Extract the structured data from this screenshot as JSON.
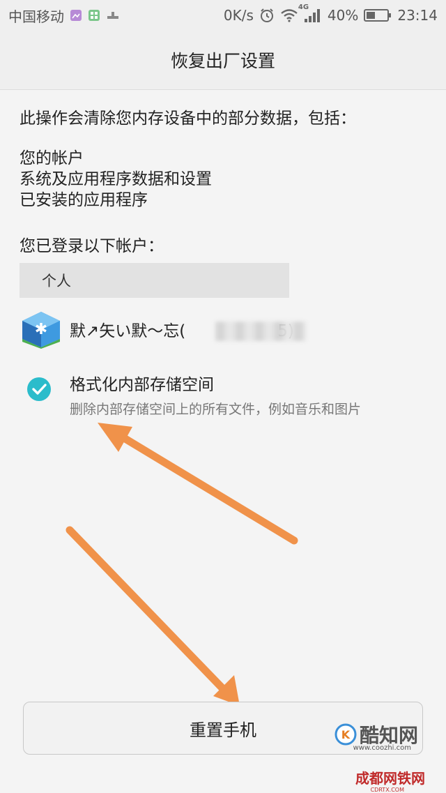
{
  "status_bar": {
    "carrier": "中国移动",
    "speed": "0K/s",
    "network": "4G",
    "battery": "40%",
    "time": "23:14"
  },
  "header": {
    "title": "恢复出厂设置"
  },
  "content": {
    "intro": "此操作会清除您内存设备中的部分数据，包括：",
    "items": [
      "您的帐户",
      "系统及应用程序数据和设置",
      "已安装的应用程序"
    ],
    "logged_in_label": "您已登录以下帐户：",
    "account_group": "个人",
    "account_name": "默↗矢い默～忘(",
    "account_suffix": "5)"
  },
  "format_option": {
    "title": "格式化内部存储空间",
    "description": "删除内部存储空间上的所有文件，例如音乐和图片",
    "checked": true
  },
  "reset_button": {
    "label": "重置手机"
  },
  "watermark": {
    "name": "酷知网",
    "domain": "www.coozhi.com",
    "bottom": "成都网铁网",
    "bottom_sub": "CDRTX.COM"
  },
  "colors": {
    "accent": "#2bbccb",
    "arrow": "#f0924a"
  }
}
